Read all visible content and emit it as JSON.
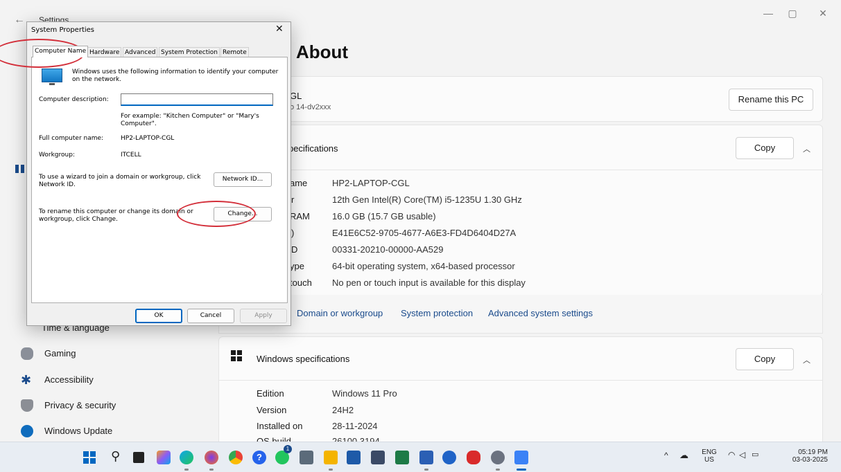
{
  "settings": {
    "window_title": "Settings",
    "page_heading": "About",
    "device": {
      "name_partial": "GL",
      "model_partial": "o 14-dv2xxx",
      "rename_button": "Rename this PC"
    },
    "device_specs": {
      "title_partial": "pecifications",
      "copy_button": "Copy",
      "rows": [
        {
          "label": "ame",
          "value": "HP2-LAPTOP-CGL"
        },
        {
          "label": "r",
          "value": "12th Gen Intel(R) Core(TM) i5-1235U   1.30 GHz"
        },
        {
          "label": "RAM",
          "value": "16.0 GB (15.7 GB usable)"
        },
        {
          "label": ")",
          "value": "E41E6C52-9705-4677-A6E3-FD4D6404D27A"
        },
        {
          "label": "D",
          "value": "00331-20210-00000-AA529"
        },
        {
          "label": "ype",
          "value": "64-bit operating system, x64-based processor"
        },
        {
          "label": "touch",
          "value": "No pen or touch input is available for this display"
        }
      ]
    },
    "related_links": [
      "Domain or workgroup",
      "System protection",
      "Advanced system settings"
    ],
    "windows_specs": {
      "title": "Windows specifications",
      "copy_button": "Copy",
      "rows": [
        {
          "label": "Edition",
          "value": "Windows 11 Pro"
        },
        {
          "label": "Version",
          "value": "24H2"
        },
        {
          "label": "Installed on",
          "value": "28-11-2024"
        },
        {
          "label": "OS build",
          "value": "26100.3194"
        }
      ]
    },
    "sidebar": {
      "partial_item": "Time & language",
      "items": [
        {
          "label": "Gaming"
        },
        {
          "label": "Accessibility"
        },
        {
          "label": "Privacy & security"
        },
        {
          "label": "Windows Update"
        }
      ]
    }
  },
  "dialog": {
    "title": "System Properties",
    "tabs": [
      "Computer Name",
      "Hardware",
      "Advanced",
      "System Protection",
      "Remote"
    ],
    "intro": "Windows uses the following information to identify your computer on the network.",
    "desc_label": "Computer description:",
    "desc_value": "",
    "example": "For example: \"Kitchen Computer\" or \"Mary's Computer\".",
    "full_name_label": "Full computer name:",
    "full_name_value": "HP2-LAPTOP-CGL",
    "workgroup_label": "Workgroup:",
    "workgroup_value": "ITCELL",
    "wizard_text": "To use a wizard to join a domain or workgroup, click Network ID.",
    "network_id_button": "Network ID...",
    "rename_text": "To rename this computer or change its domain or workgroup, click Change.",
    "change_button": "Change...",
    "ok": "OK",
    "cancel": "Cancel",
    "apply": "Apply"
  },
  "taskbar": {
    "language": "ENG",
    "region": "US",
    "time": "05:19 PM",
    "date": "03-03-2025",
    "whatsapp_badge": "1",
    "accent": "#0067c0"
  }
}
